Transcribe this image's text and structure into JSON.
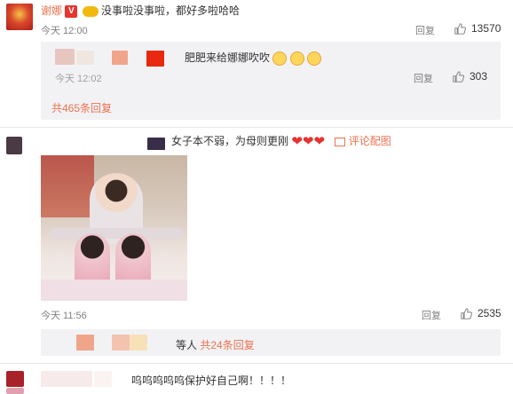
{
  "comment1": {
    "username": "谢娜",
    "text": "没事啦没事啦，都好多啦哈哈",
    "time": "今天 12:00",
    "reply_label": "回复",
    "likes": "13570",
    "sub_reply": {
      "text": "肥肥来给娜娜吹吹",
      "time": "今天 12:02",
      "reply_label": "回复",
      "likes": "303"
    },
    "more_replies": "共465条回复"
  },
  "comment2": {
    "text": "女子本不弱，为母则更刚",
    "hearts": "❤❤❤",
    "image_link": "评论配图",
    "time": "今天 11:56",
    "reply_label": "回复",
    "likes": "2535",
    "reply_summary_prefix": "等人",
    "reply_summary_link": "共24条回复"
  },
  "comment3": {
    "text": "呜呜呜呜呜保护好自己啊！！！！"
  },
  "colors": {
    "accent": "#eb7350",
    "heart": "#e8322e",
    "muted": "#808080"
  }
}
